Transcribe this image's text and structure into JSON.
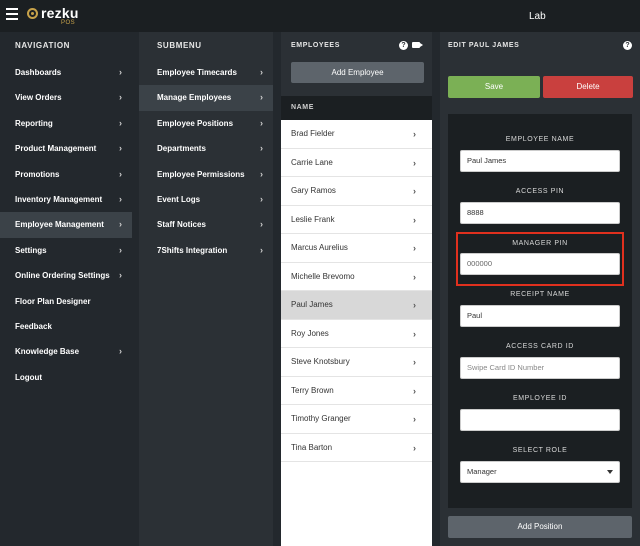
{
  "app": {
    "brand": "rezku",
    "brand_sub": "POS",
    "location": "Lab"
  },
  "navigation": {
    "title": "NAVIGATION",
    "items": [
      {
        "label": "Dashboards",
        "chevron": true
      },
      {
        "label": "View Orders",
        "chevron": true
      },
      {
        "label": "Reporting",
        "chevron": true
      },
      {
        "label": "Product Management",
        "chevron": true
      },
      {
        "label": "Promotions",
        "chevron": true
      },
      {
        "label": "Inventory Management",
        "chevron": true
      },
      {
        "label": "Employee Management",
        "chevron": true,
        "active": true
      },
      {
        "label": "Settings",
        "chevron": true
      },
      {
        "label": "Online Ordering Settings",
        "chevron": true
      },
      {
        "label": "Floor Plan Designer",
        "chevron": false
      },
      {
        "label": "Feedback",
        "chevron": false
      },
      {
        "label": "Knowledge Base",
        "chevron": true
      },
      {
        "label": "Logout",
        "chevron": false
      }
    ]
  },
  "submenu": {
    "title": "SUBMENU",
    "items": [
      {
        "label": "Employee Timecards",
        "chevron": true
      },
      {
        "label": "Manage Employees",
        "chevron": true,
        "active": true
      },
      {
        "label": "Employee Positions",
        "chevron": true
      },
      {
        "label": "Departments",
        "chevron": true
      },
      {
        "label": "Employee Permissions",
        "chevron": true
      },
      {
        "label": "Event Logs",
        "chevron": true
      },
      {
        "label": "Staff Notices",
        "chevron": true
      },
      {
        "label": "7Shifts Integration",
        "chevron": true
      }
    ]
  },
  "employees": {
    "title": "EMPLOYEES",
    "add_label": "Add Employee",
    "column_header": "NAME",
    "list": [
      {
        "name": "Brad Fielder"
      },
      {
        "name": "Carrie Lane"
      },
      {
        "name": "Gary Ramos"
      },
      {
        "name": "Leslie Frank"
      },
      {
        "name": "Marcus Aurelius"
      },
      {
        "name": "Michelle Brevomo"
      },
      {
        "name": "Paul James",
        "active": true
      },
      {
        "name": "Roy Jones"
      },
      {
        "name": "Steve Knotsbury"
      },
      {
        "name": "Terry Brown"
      },
      {
        "name": "Timothy Granger"
      },
      {
        "name": "Tina Barton"
      }
    ]
  },
  "edit": {
    "title": "EDIT PAUL JAMES",
    "save_label": "Save",
    "delete_label": "Delete",
    "fields": {
      "employee_name": {
        "label": "EMPLOYEE NAME",
        "value": "Paul James"
      },
      "access_pin": {
        "label": "ACCESS PIN",
        "value": "8888"
      },
      "manager_pin": {
        "label": "MANAGER PIN",
        "value": "000000"
      },
      "receipt_name": {
        "label": "RECEIPT NAME",
        "value": "Paul"
      },
      "access_card_id": {
        "label": "ACCESS CARD ID",
        "placeholder": "Swipe Card ID Number"
      },
      "employee_id": {
        "label": "EMPLOYEE ID",
        "value": ""
      },
      "select_role": {
        "label": "SELECT ROLE",
        "value": "Manager"
      }
    },
    "add_position_label": "Add Position"
  },
  "colors": {
    "save": "#7bb055",
    "delete": "#c9403e",
    "highlight": "#e0301e"
  }
}
